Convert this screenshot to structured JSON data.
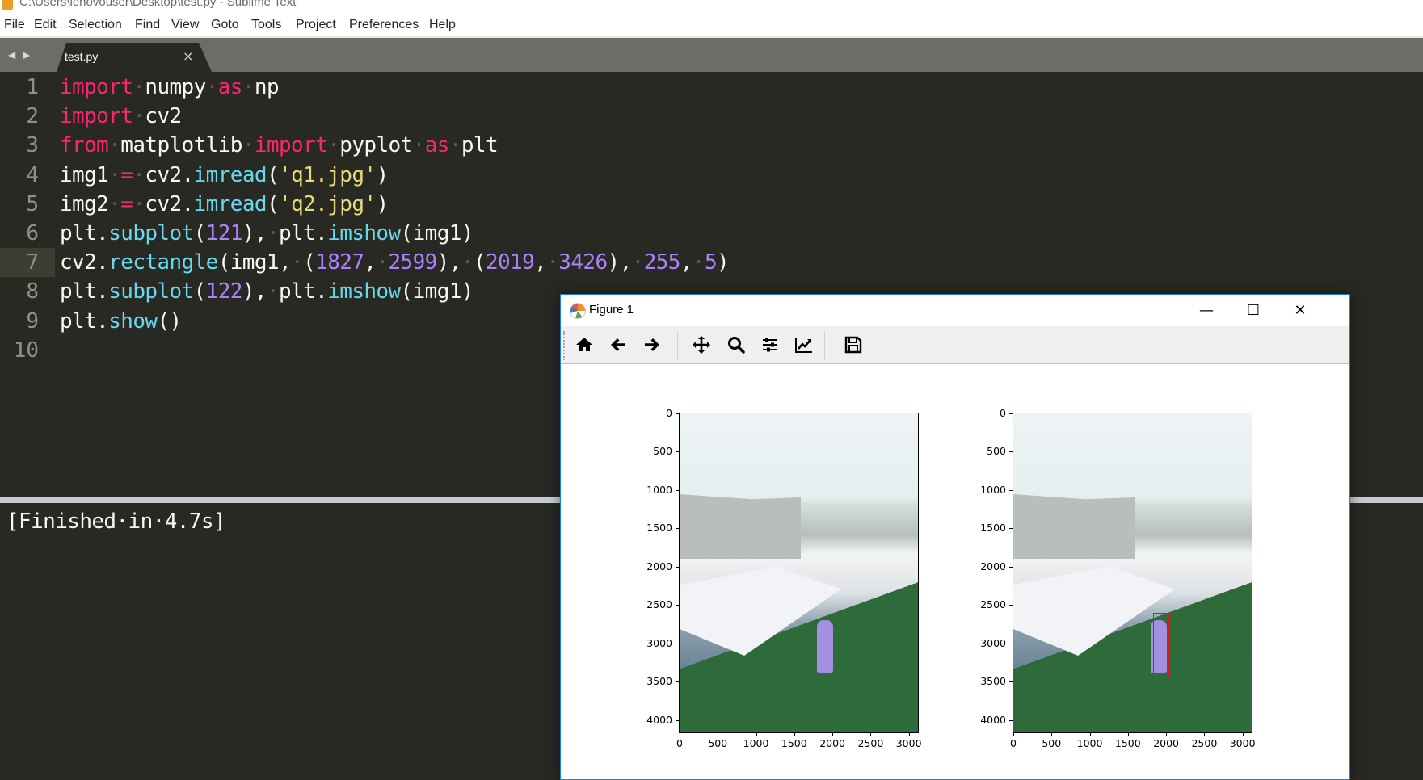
{
  "window": {
    "title": "C:\\Users\\lenovouser\\Desktop\\test.py - Sublime Text"
  },
  "menu": [
    "File",
    "Edit",
    "Selection",
    "Find",
    "View",
    "Goto",
    "Tools",
    "Project",
    "Preferences",
    "Help"
  ],
  "tabs": [
    {
      "label": "test.py",
      "active": true,
      "close": "×"
    }
  ],
  "tab_nav": {
    "prev": "◀",
    "next": "▶"
  },
  "editor": {
    "active_line": 7,
    "lines": [
      {
        "n": "1",
        "tokens": [
          [
            "kw",
            "import"
          ],
          [
            "dot",
            "·"
          ],
          [
            "",
            "numpy"
          ],
          [
            "dot",
            "·"
          ],
          [
            "kw",
            "as"
          ],
          [
            "dot",
            "·"
          ],
          [
            "",
            "np"
          ]
        ]
      },
      {
        "n": "2",
        "tokens": [
          [
            "kw",
            "import"
          ],
          [
            "dot",
            "·"
          ],
          [
            "",
            "cv2"
          ]
        ]
      },
      {
        "n": "3",
        "tokens": [
          [
            "kw",
            "from"
          ],
          [
            "dot",
            "·"
          ],
          [
            "",
            "matplotlib"
          ],
          [
            "dot",
            "·"
          ],
          [
            "kw",
            "import"
          ],
          [
            "dot",
            "·"
          ],
          [
            "",
            "pyplot"
          ],
          [
            "dot",
            "·"
          ],
          [
            "kw",
            "as"
          ],
          [
            "dot",
            "·"
          ],
          [
            "",
            "plt"
          ]
        ]
      },
      {
        "n": "4",
        "tokens": [
          [
            "",
            "img1"
          ],
          [
            "dot",
            "·"
          ],
          [
            "kw",
            "="
          ],
          [
            "dot",
            "·"
          ],
          [
            "",
            "cv2."
          ],
          [
            "fn",
            "imread"
          ],
          [
            "",
            "("
          ],
          [
            "str",
            "'q1.jpg'"
          ],
          [
            "",
            ")"
          ]
        ]
      },
      {
        "n": "5",
        "tokens": [
          [
            "",
            "img2"
          ],
          [
            "dot",
            "·"
          ],
          [
            "kw",
            "="
          ],
          [
            "dot",
            "·"
          ],
          [
            "",
            "cv2."
          ],
          [
            "fn",
            "imread"
          ],
          [
            "",
            "("
          ],
          [
            "str",
            "'q2.jpg'"
          ],
          [
            "",
            ")"
          ]
        ]
      },
      {
        "n": "6",
        "tokens": [
          [
            "",
            "plt."
          ],
          [
            "fn",
            "subplot"
          ],
          [
            "",
            "("
          ],
          [
            "num",
            "121"
          ],
          [
            "",
            "),"
          ],
          [
            "dot",
            "·"
          ],
          [
            "",
            "plt."
          ],
          [
            "fn",
            "imshow"
          ],
          [
            "",
            "(img1)"
          ]
        ]
      },
      {
        "n": "7",
        "tokens": [
          [
            "",
            "cv2."
          ],
          [
            "fn",
            "rectangle"
          ],
          [
            "",
            "(img1,"
          ],
          [
            "dot",
            "·"
          ],
          [
            "",
            "("
          ],
          [
            "num",
            "1827"
          ],
          [
            "",
            ","
          ],
          [
            "dot",
            "·"
          ],
          [
            "num",
            "2599"
          ],
          [
            "",
            "),"
          ],
          [
            "dot",
            "·"
          ],
          [
            "",
            "("
          ],
          [
            "num",
            "2019"
          ],
          [
            "",
            ","
          ],
          [
            "dot",
            "·"
          ],
          [
            "num",
            "3426"
          ],
          [
            "",
            "),"
          ],
          [
            "dot",
            "·"
          ],
          [
            "num",
            "255"
          ],
          [
            "",
            ","
          ],
          [
            "dot",
            "·"
          ],
          [
            "num",
            "5"
          ],
          [
            "",
            ")"
          ]
        ]
      },
      {
        "n": "8",
        "tokens": [
          [
            "",
            "plt."
          ],
          [
            "fn",
            "subplot"
          ],
          [
            "",
            "("
          ],
          [
            "num",
            "122"
          ],
          [
            "",
            "),"
          ],
          [
            "dot",
            "·"
          ],
          [
            "",
            "plt."
          ],
          [
            "fn",
            "imshow"
          ],
          [
            "",
            "(img1)"
          ]
        ]
      },
      {
        "n": "9",
        "tokens": [
          [
            "",
            "plt."
          ],
          [
            "fn",
            "show"
          ],
          [
            "",
            "()"
          ]
        ]
      },
      {
        "n": "10",
        "tokens": []
      }
    ]
  },
  "output_panel": {
    "text": "[Finished·in·4.7s]"
  },
  "figure": {
    "title": "Figure 1",
    "window_buttons": {
      "minimize": "—",
      "maximize": "☐",
      "close": "✕"
    },
    "toolbar": [
      {
        "name": "home-icon",
        "tooltip": "Home"
      },
      {
        "name": "back-icon",
        "tooltip": "Back"
      },
      {
        "name": "forward-icon",
        "tooltip": "Forward"
      },
      {
        "name": "pan-icon",
        "tooltip": "Pan"
      },
      {
        "name": "zoom-icon",
        "tooltip": "Zoom"
      },
      {
        "name": "subplots-icon",
        "tooltip": "Configure subplots"
      },
      {
        "name": "edit-axis-icon",
        "tooltip": "Edit axis"
      },
      {
        "name": "save-icon",
        "tooltip": "Save"
      }
    ]
  },
  "chart_data": [
    {
      "type": "image",
      "subplot": "121",
      "title": "",
      "xlim": [
        0,
        3120
      ],
      "ylim": [
        4160,
        0
      ],
      "xticks": [
        "0",
        "500",
        "1000",
        "1500",
        "2000",
        "2500",
        "3000"
      ],
      "yticks": [
        "0",
        "500",
        "1000",
        "1500",
        "2000",
        "2500",
        "3000",
        "3500",
        "4000"
      ],
      "annotations": []
    },
    {
      "type": "image",
      "subplot": "122",
      "title": "",
      "xlim": [
        0,
        3120
      ],
      "ylim": [
        4160,
        0
      ],
      "xticks": [
        "0",
        "500",
        "1000",
        "1500",
        "2000",
        "2500",
        "3000"
      ],
      "yticks": [
        "0",
        "500",
        "1000",
        "1500",
        "2000",
        "2500",
        "3000",
        "3500",
        "4000"
      ],
      "annotations": [
        {
          "type": "rectangle",
          "x0": 1827,
          "y0": 2599,
          "x1": 2019,
          "y1": 3426,
          "color": "#e8141c"
        }
      ]
    }
  ]
}
